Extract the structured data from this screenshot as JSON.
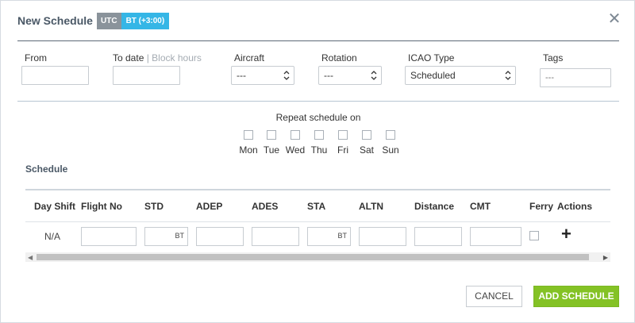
{
  "dialog": {
    "title": "New Schedule",
    "tz_utc": "UTC",
    "tz_bt": "BT (+3:00)",
    "close_glyph": "✕"
  },
  "fields": {
    "from_label": "From",
    "from_value": "",
    "todate_label": "To date",
    "todate_sep": " | ",
    "block_hours_label": "Block hours",
    "todate_value": "",
    "aircraft_label": "Aircraft",
    "aircraft_value": "---",
    "rotation_label": "Rotation",
    "rotation_value": "---",
    "icao_label": "ICAO Type",
    "icao_value": "Scheduled",
    "tags_label": "Tags",
    "tags_placeholder": "---"
  },
  "repeat": {
    "title": "Repeat schedule on",
    "days": [
      "Mon",
      "Tue",
      "Wed",
      "Thu",
      "Fri",
      "Sat",
      "Sun"
    ]
  },
  "schedule": {
    "section_title": "Schedule",
    "columns": [
      "Day Shift",
      "Flight No",
      "STD",
      "ADEP",
      "ADES",
      "STA",
      "ALTN",
      "Distance",
      "CMT",
      "Ferry",
      "Actions"
    ],
    "row": {
      "day_shift": "N/A",
      "std_suffix": "BT",
      "sta_suffix": "BT",
      "add_glyph": "+"
    }
  },
  "buttons": {
    "cancel": "CANCEL",
    "add_schedule": "ADD SCHEDULE"
  },
  "colors": {
    "accent_green": "#84c225",
    "tz_blue": "#35b6e6",
    "tz_grey": "#8a939b"
  }
}
